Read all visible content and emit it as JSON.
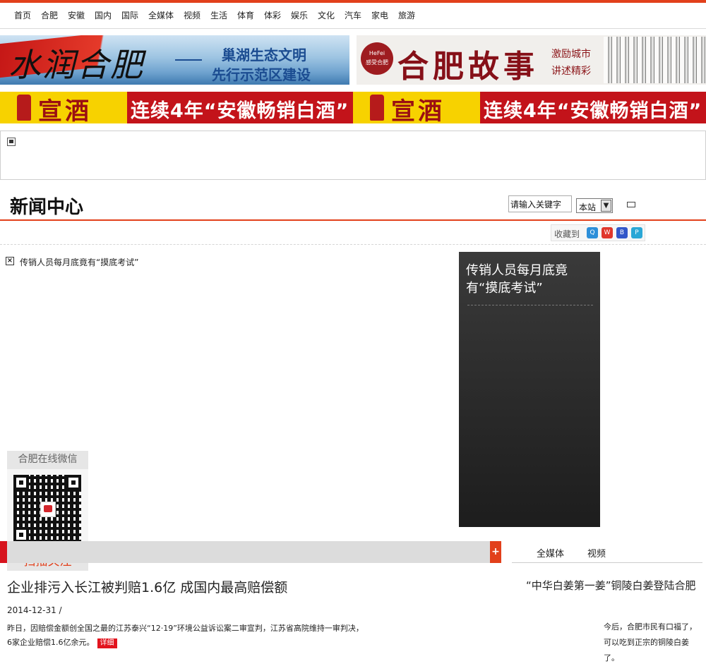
{
  "nav": {
    "items": [
      "首页",
      "合肥",
      "安徽",
      "国内",
      "国际",
      "全媒体",
      "视频",
      "生活",
      "体育",
      "体彩",
      "娱乐",
      "文化",
      "汽车",
      "家电",
      "旅游"
    ]
  },
  "banners": {
    "b1": {
      "calligraphy": "水润合肥",
      "line1": "巢湖生态文明",
      "line2": "先行示范区建设"
    },
    "b2": {
      "logo_top": "HeFei",
      "logo_bottom": "感受合肥",
      "calligraphy": "合肥故事",
      "tag1": "激励城市",
      "tag2": "讲述精彩"
    }
  },
  "ads": [
    {
      "brand": "宣酒",
      "slogan": "连续4年“安徽畅销白酒”"
    },
    {
      "brand": "宣酒",
      "slogan": "连续4年“安徽畅销白酒”"
    }
  ],
  "header": {
    "title": "新闻中心",
    "search_placeholder": "请输入关键字",
    "scope": "本站"
  },
  "favorites": {
    "label": "收藏到"
  },
  "slideshow": {
    "caption": "传销人员每月底竟有“摸底考试”",
    "panel_title": "传销人员每月底竟有“摸底考试”"
  },
  "wechat": {
    "title": "合肥在线微信",
    "footer": "扫描关注"
  },
  "news": {
    "plus": "+",
    "headline": "企业排污入长江被判赔1.6亿 成国内最高赔偿额",
    "date": "2014-12-31 /",
    "summary": "昨日，因赔偿金额创全国之最的江苏泰兴“12·19”环境公益诉讼案二审宣判，江苏省高院维持一审判决，6家企业赔偿1.6亿余元。",
    "detail": "详细"
  },
  "side": {
    "tabs": [
      "全媒体",
      "视频"
    ],
    "title": "“中华白姜第一姜”铜陵白姜登陆合肥",
    "text": "今后，合肥市民有口福了，可以吃到正宗的铜陵白姜了。"
  },
  "colors": {
    "accent": "#e2401b",
    "ad_red": "#c3131a",
    "ad_yellow": "#f7d200"
  }
}
